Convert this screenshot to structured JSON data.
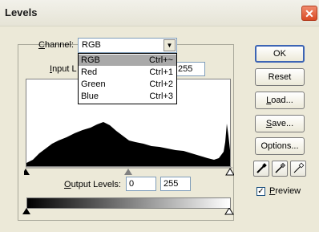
{
  "window": {
    "title": "Levels",
    "close_glyph": "✕"
  },
  "channel": {
    "label_prefix": "",
    "label_mnemonic": "C",
    "label_rest": "hannel:",
    "selected": "RGB",
    "options": [
      {
        "name": "RGB",
        "shortcut": "Ctrl+~"
      },
      {
        "name": "Red",
        "shortcut": "Ctrl+1"
      },
      {
        "name": "Green",
        "shortcut": "Ctrl+2"
      },
      {
        "name": "Blue",
        "shortcut": "Ctrl+3"
      }
    ]
  },
  "input_levels": {
    "label_prefix": "",
    "label_mnemonic": "I",
    "label_rest": "nput L",
    "value_visible": "255"
  },
  "output_levels": {
    "label_prefix": "",
    "label_mnemonic": "O",
    "label_rest": "utput Levels:",
    "low": "0",
    "high": "255"
  },
  "buttons": {
    "ok": "OK",
    "reset": "Reset",
    "load_mnemonic": "L",
    "load_rest": "oad...",
    "save_mnemonic": "S",
    "save_rest": "ave...",
    "options": "Options..."
  },
  "preview": {
    "checked": true,
    "check_glyph": "✓",
    "mnemonic": "P",
    "rest": "review"
  },
  "icons": [
    "dropdown-arrow-icon",
    "black-eyedropper-icon",
    "gray-eyedropper-icon",
    "white-eyedropper-icon"
  ]
}
